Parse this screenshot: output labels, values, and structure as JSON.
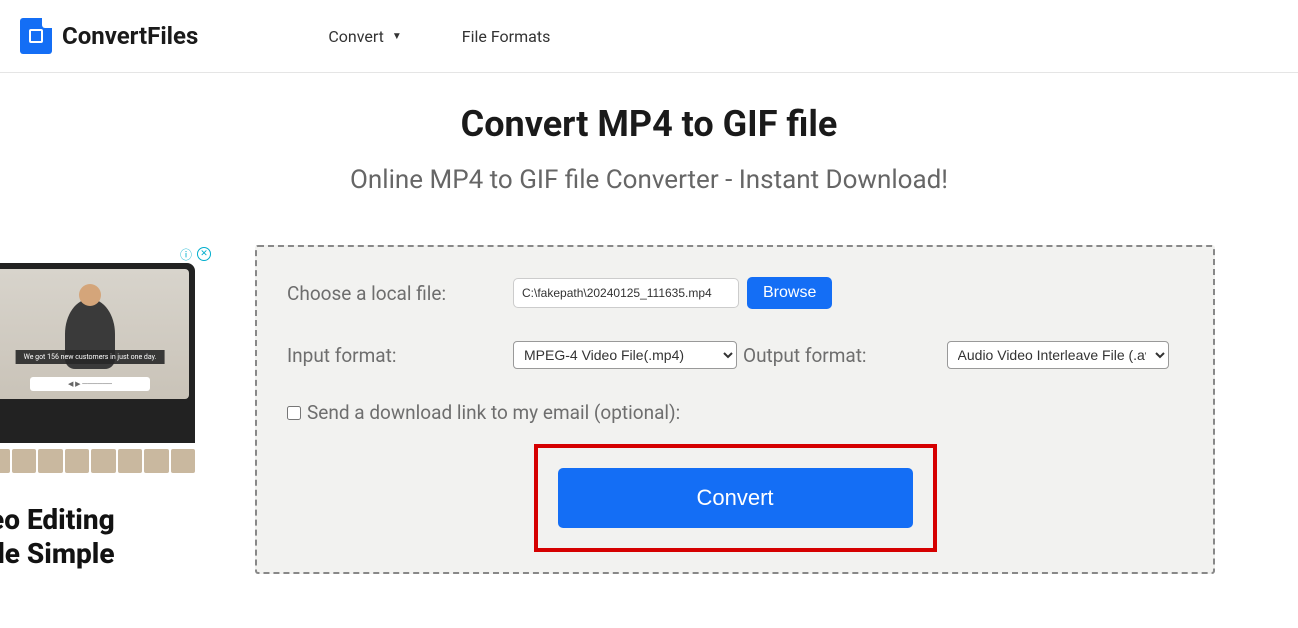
{
  "header": {
    "brand": "ConvertFiles",
    "nav": {
      "convert": "Convert",
      "file_formats": "File Formats"
    }
  },
  "page": {
    "title": "Convert MP4 to GIF file",
    "subtitle": "Online MP4 to GIF file Converter - Instant Download!"
  },
  "ad": {
    "banner_text": "We got 156 new customers in just one day.",
    "heading_line1": "eo Editing",
    "heading_line2": "de Simple"
  },
  "form": {
    "choose_file_label": "Choose a local file:",
    "file_value": "C:\\fakepath\\20240125_111635.mp4",
    "browse_label": "Browse",
    "input_format_label": "Input format:",
    "input_format_value": "MPEG-4 Video File(.mp4)",
    "output_format_label": "Output format:",
    "output_format_value": "Audio Video Interleave File (.avi)",
    "email_checkbox_label": "Send a download link to my email (optional):",
    "convert_label": "Convert"
  }
}
